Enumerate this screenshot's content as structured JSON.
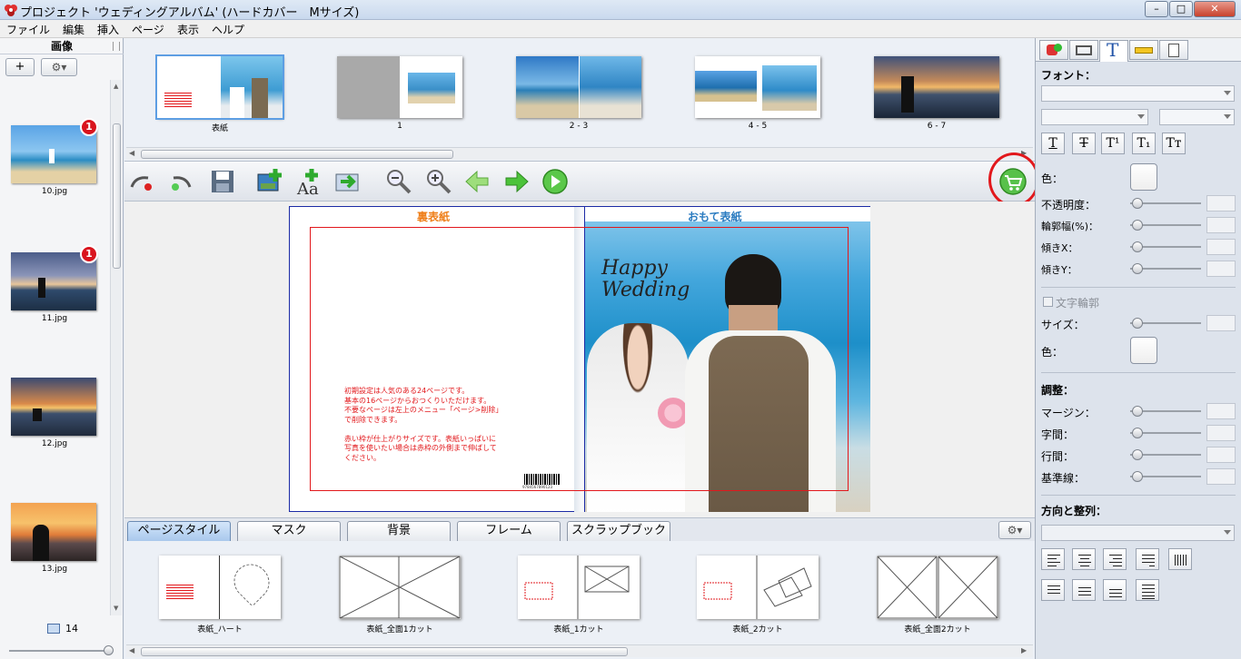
{
  "window": {
    "title": "プロジェクト 'ウェディングアルバム' (ハードカバー　Mサイズ)",
    "minimize": "–",
    "maximize": "□",
    "close": "✕"
  },
  "menu": [
    "ファイル",
    "編集",
    "挿入",
    "ページ",
    "表示",
    "ヘルプ"
  ],
  "left_panel": {
    "header": "画像",
    "add_label": "+",
    "images": [
      {
        "name": "10.jpg",
        "badge": "1"
      },
      {
        "name": "11.jpg",
        "badge": "1"
      },
      {
        "name": "12.jpg",
        "badge": ""
      },
      {
        "name": "13.jpg",
        "badge": ""
      }
    ],
    "image_count": "14"
  },
  "page_strip": [
    {
      "label": "表紙",
      "selected": true
    },
    {
      "label": "1"
    },
    {
      "label": "2 - 3"
    },
    {
      "label": "4 - 5"
    },
    {
      "label": "6 - 7"
    }
  ],
  "toolbar": {
    "icons": [
      "undo-icon",
      "redo-icon",
      "save-icon",
      "add-photo-icon",
      "add-text-icon",
      "import-icon",
      "zoom-out-icon",
      "zoom-in-icon",
      "prev-page-icon",
      "next-page-icon",
      "play-icon",
      "cart-icon"
    ]
  },
  "cover": {
    "back_label": "裏表紙",
    "front_label": "おもて表紙",
    "back_text_lines": [
      "初期設定は人気のある24ページです。",
      "基本の16ページからおつくりいただけます。",
      "不要なページは左上のメニュー「ページ>削除」",
      "で削除できます。",
      "",
      "赤い枠が仕上がりサイズです。表紙いっぱいに",
      "写真を使いたい場合は赤枠の外側まで伸ばして",
      "ください。"
    ],
    "overlay_text": "Happy Wedding",
    "barcode_number": "9784567890123"
  },
  "bottom_tabs": [
    "ページスタイル",
    "マスク",
    "背景",
    "フレーム",
    "スクラップブック"
  ],
  "layouts": [
    {
      "label": "表紙_ハート"
    },
    {
      "label": "表紙_全面1カット"
    },
    {
      "label": "表紙_1カット"
    },
    {
      "label": "表紙_2カット"
    },
    {
      "label": "表紙_全面2カット"
    }
  ],
  "right_panel": {
    "font_heading": "フォント：",
    "format_buttons": [
      "T",
      "T",
      "T¹",
      "T₁",
      "Tт"
    ],
    "color_label": "色：",
    "opacity_label": "不透明度：",
    "outline_width_label": "輪郭幅(%)：",
    "skew_x_label": "傾きX：",
    "skew_y_label": "傾きY：",
    "text_outline_label": "文字輪郭",
    "size_label": "サイズ：",
    "outline_color_label": "色：",
    "adjust_heading": "調整：",
    "margin_label": "マージン：",
    "char_spacing_label": "字間：",
    "line_spacing_label": "行間：",
    "baseline_label": "基準線：",
    "direction_heading": "方向と整列："
  },
  "colors": {
    "accent_red": "#e2181c",
    "front_label_blue": "#2a7bc0",
    "back_label_orange": "#ef7f1a"
  }
}
